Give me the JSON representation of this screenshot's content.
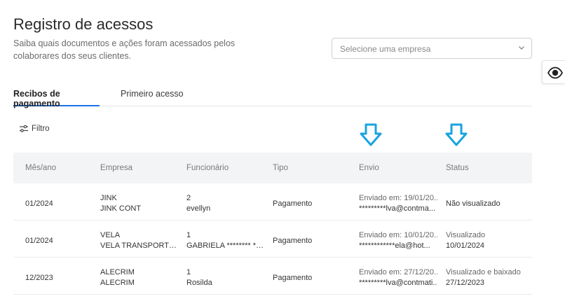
{
  "header": {
    "title": "Registro de acessos",
    "subtitle": "Saiba quais documentos e ações foram acessados pelos colaborares dos seus clientes."
  },
  "company_select": {
    "placeholder": "Selecione uma empresa"
  },
  "tabs": [
    {
      "label": "Recibos de pagamento",
      "active": true
    },
    {
      "label": "Primeiro acesso",
      "active": false
    }
  ],
  "filter": {
    "label": "Filtro"
  },
  "colors": {
    "accent": "#1a73e8",
    "arrow": "#1aa3e0",
    "header_bg": "#f3f4f6"
  },
  "table": {
    "columns": [
      "Mês/ano",
      "Empresa",
      "Funcionário",
      "Tipo",
      "Envio",
      "Status"
    ],
    "rows": [
      {
        "mes": "01/2024",
        "empresa_1": "JINK",
        "empresa_2": "JINK CONT",
        "func_1": "2",
        "func_2": "evellyn",
        "tipo": "Pagamento",
        "envio_1": "Enviado em: 19/01/20...",
        "envio_2": "*********lva@contma...",
        "status_1": "Não visualizado",
        "status_2": ""
      },
      {
        "mes": "01/2024",
        "empresa_1": "VELA",
        "empresa_2": "VELA TRANSPORTES ...",
        "func_1": "1",
        "func_2": "GABRIELA ******** ***...",
        "tipo": "Pagamento",
        "envio_1": "Enviado em: 10/01/20...",
        "envio_2": "************ela@hot...",
        "status_1": "Visualizado",
        "status_2": "10/01/2024"
      },
      {
        "mes": "12/2023",
        "empresa_1": "ALECRIM",
        "empresa_2": "ALECRIM",
        "func_1": "1",
        "func_2": "Rosilda",
        "tipo": "Pagamento",
        "envio_1": "Enviado em: 27/12/20...",
        "envio_2": "*********lva@contmati...",
        "status_1": "Visualizado e baixado",
        "status_2": "27/12/2023"
      }
    ]
  }
}
